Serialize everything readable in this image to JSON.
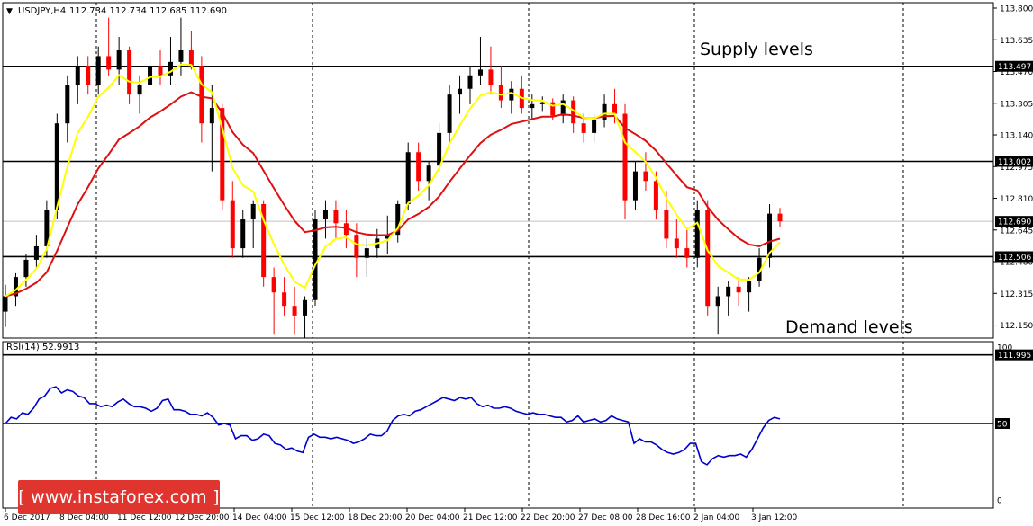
{
  "header": {
    "arrow": "▼",
    "symbol": "USDJPY,H4",
    "ohlc": "112.734 112.734 112.685 112.690"
  },
  "annotations": {
    "supply": "Supply levels",
    "demand": "Demand levels"
  },
  "watermark": "[ www.instaforex.com ]",
  "colors": {
    "bull": "#000000",
    "bear": "#ff0000",
    "ema_fast": "#ffff00",
    "ema_slow": "#dd1111",
    "rsi": "#0000cc",
    "level": "#000000"
  },
  "chart_data": [
    {
      "type": "candlestick",
      "title": "USDJPY,H4",
      "ylim": [
        112.0,
        113.8
      ],
      "yticks": [
        "113.800",
        "113.635",
        "113.470",
        "113.305",
        "113.140",
        "112.975",
        "112.810",
        "112.645",
        "112.480",
        "112.315",
        "112.150"
      ],
      "price_labels": [
        "113.497",
        "113.002",
        "112.690",
        "112.506",
        "111.995"
      ],
      "levels": [
        {
          "label": "113.497",
          "value": 113.497
        },
        {
          "label": "113.002",
          "value": 113.002
        },
        {
          "label": "112.506",
          "value": 112.506
        },
        {
          "label": "111.995",
          "value": 111.995
        }
      ],
      "current_price": 112.69,
      "xticks": [
        "6 Dec 2017",
        "8 Dec 04:00",
        "11 Dec 12:00",
        "12 Dec 20:00",
        "14 Dec 04:00",
        "15 Dec 12:00",
        "18 Dec 20:00",
        "20 Dec 04:00",
        "21 Dec 12:00",
        "22 Dec 20:00",
        "27 Dec 08:00",
        "28 Dec 16:00",
        "2 Jan 04:00",
        "3 Jan 12:00"
      ],
      "candles": [
        [
          112.22,
          112.36,
          112.14,
          112.3
        ],
        [
          112.3,
          112.42,
          112.25,
          112.4
        ],
        [
          112.4,
          112.52,
          112.35,
          112.49
        ],
        [
          112.49,
          112.62,
          112.44,
          112.56
        ],
        [
          112.56,
          112.8,
          112.5,
          112.75
        ],
        [
          112.75,
          113.25,
          112.7,
          113.2
        ],
        [
          113.2,
          113.45,
          113.1,
          113.4
        ],
        [
          113.4,
          113.55,
          113.3,
          113.5
        ],
        [
          113.5,
          113.55,
          113.35,
          113.4
        ],
        [
          113.4,
          113.6,
          113.35,
          113.55
        ],
        [
          113.55,
          113.75,
          113.45,
          113.48
        ],
        [
          113.48,
          113.65,
          113.4,
          113.58
        ],
        [
          113.58,
          113.6,
          113.3,
          113.35
        ],
        [
          113.35,
          113.45,
          113.25,
          113.4
        ],
        [
          113.4,
          113.55,
          113.38,
          113.5
        ],
        [
          113.5,
          113.58,
          113.4,
          113.45
        ],
        [
          113.45,
          113.65,
          113.4,
          113.52
        ],
        [
          113.52,
          113.75,
          113.45,
          113.58
        ],
        [
          113.58,
          113.68,
          113.48,
          113.5
        ],
        [
          113.5,
          113.55,
          113.1,
          113.2
        ],
        [
          113.2,
          113.4,
          112.95,
          113.28
        ],
        [
          113.28,
          113.3,
          112.75,
          112.8
        ],
        [
          112.8,
          112.9,
          112.5,
          112.55
        ],
        [
          112.55,
          112.75,
          112.5,
          112.7
        ],
        [
          112.7,
          112.8,
          112.55,
          112.78
        ],
        [
          112.78,
          112.8,
          112.35,
          112.4
        ],
        [
          112.4,
          112.45,
          112.1,
          112.32
        ],
        [
          112.32,
          112.4,
          112.2,
          112.25
        ],
        [
          112.25,
          112.35,
          112.1,
          112.2
        ],
        [
          112.2,
          112.3,
          112.08,
          112.28
        ],
        [
          112.28,
          112.75,
          112.25,
          112.7
        ],
        [
          112.7,
          112.8,
          112.6,
          112.75
        ],
        [
          112.75,
          112.8,
          112.6,
          112.68
        ],
        [
          112.68,
          112.75,
          112.55,
          112.62
        ],
        [
          112.62,
          112.68,
          112.4,
          112.5
        ],
        [
          112.5,
          112.6,
          112.4,
          112.55
        ],
        [
          112.55,
          112.65,
          112.5,
          112.6
        ],
        [
          112.6,
          112.72,
          112.52,
          112.62
        ],
        [
          112.62,
          112.8,
          112.58,
          112.78
        ],
        [
          112.78,
          113.1,
          112.75,
          113.05
        ],
        [
          113.05,
          113.1,
          112.85,
          112.9
        ],
        [
          112.9,
          113.0,
          112.8,
          112.98
        ],
        [
          112.98,
          113.2,
          112.95,
          113.15
        ],
        [
          113.15,
          113.4,
          113.1,
          113.35
        ],
        [
          113.35,
          113.45,
          113.25,
          113.38
        ],
        [
          113.38,
          113.5,
          113.3,
          113.45
        ],
        [
          113.45,
          113.65,
          113.4,
          113.48
        ],
        [
          113.48,
          113.6,
          113.35,
          113.4
        ],
        [
          113.4,
          113.5,
          113.28,
          113.32
        ],
        [
          113.32,
          113.42,
          113.25,
          113.38
        ],
        [
          113.38,
          113.45,
          113.25,
          113.28
        ],
        [
          113.28,
          113.35,
          113.22,
          113.3
        ],
        [
          113.3,
          113.34,
          113.26,
          113.31
        ],
        [
          113.31,
          113.33,
          113.22,
          113.24
        ],
        [
          113.24,
          113.35,
          113.2,
          113.32
        ],
        [
          113.32,
          113.34,
          113.15,
          113.2
        ],
        [
          113.2,
          113.25,
          113.1,
          113.15
        ],
        [
          113.15,
          113.25,
          113.1,
          113.22
        ],
        [
          113.22,
          113.35,
          113.18,
          113.3
        ],
        [
          113.3,
          113.38,
          113.2,
          113.25
        ],
        [
          113.25,
          113.3,
          112.7,
          112.8
        ],
        [
          112.8,
          113.0,
          112.75,
          112.95
        ],
        [
          112.95,
          113.05,
          112.85,
          112.9
        ],
        [
          112.9,
          112.95,
          112.7,
          112.75
        ],
        [
          112.75,
          112.85,
          112.55,
          112.6
        ],
        [
          112.6,
          112.7,
          112.5,
          112.55
        ],
        [
          112.55,
          112.65,
          112.45,
          112.5
        ],
        [
          112.5,
          112.8,
          112.45,
          112.75
        ],
        [
          112.75,
          112.8,
          112.2,
          112.25
        ],
        [
          112.25,
          112.35,
          112.1,
          112.3
        ],
        [
          112.3,
          112.38,
          112.2,
          112.35
        ],
        [
          112.35,
          112.4,
          112.25,
          112.32
        ],
        [
          112.32,
          112.4,
          112.22,
          112.38
        ],
        [
          112.38,
          112.55,
          112.35,
          112.5
        ],
        [
          112.5,
          112.78,
          112.45,
          112.73
        ],
        [
          112.73,
          112.76,
          112.66,
          112.69
        ]
      ]
    },
    {
      "type": "line",
      "title": "RSI(14) 52.9913",
      "ylim": [
        0,
        100
      ],
      "yticks": [
        "100",
        "50",
        "0"
      ],
      "level": 50,
      "series": [
        {
          "values": [
            50,
            54,
            53,
            57,
            56,
            60,
            66,
            68,
            73,
            74,
            70,
            72,
            71,
            68,
            67,
            63,
            63,
            61,
            62,
            61,
            64,
            66,
            63,
            61,
            61,
            60,
            58,
            60,
            65,
            66,
            59,
            59,
            58,
            56,
            56,
            55,
            57,
            54,
            49,
            50,
            49,
            40,
            42,
            42,
            39,
            40,
            43,
            42,
            37,
            36,
            33,
            34,
            32,
            31,
            41,
            43,
            41,
            41,
            40,
            41,
            40,
            39,
            37,
            38,
            40,
            43,
            42,
            42,
            45,
            52,
            55,
            56,
            55,
            58,
            59,
            61,
            63,
            65,
            67,
            66,
            65,
            67,
            66,
            67,
            63,
            61,
            62,
            60,
            60,
            61,
            60,
            58,
            57,
            56,
            57,
            56,
            56,
            55,
            54,
            54,
            51,
            52,
            55,
            51,
            52,
            53,
            51,
            52,
            55,
            53,
            52,
            51,
            37,
            40,
            38,
            38,
            36,
            33,
            31,
            30,
            31,
            33,
            37,
            37,
            25,
            23,
            27,
            29,
            28,
            29,
            29,
            30,
            28,
            33,
            40,
            47,
            52,
            54,
            53
          ]
        }
      ]
    }
  ]
}
